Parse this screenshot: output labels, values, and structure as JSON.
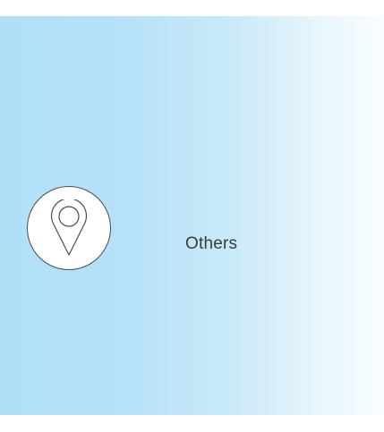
{
  "item": {
    "label": "Others",
    "icon": "map-pin-icon"
  },
  "colors": {
    "panel_gradient_start": "#b1dff8",
    "panel_gradient_end": "#f9fdff",
    "icon_stroke": "#4d4d4d",
    "label_text": "#3a3a3a"
  }
}
